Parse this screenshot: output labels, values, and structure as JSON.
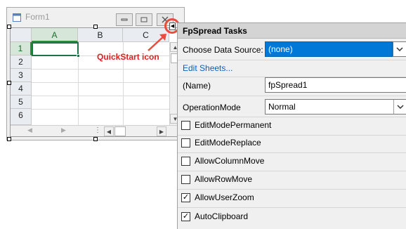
{
  "form": {
    "title": "Form1",
    "caption_buttons": [
      "minimize-button",
      "maximize-button",
      "close-button"
    ]
  },
  "spread": {
    "columns": [
      "A",
      "B",
      "C"
    ],
    "rows": [
      "1",
      "2",
      "3",
      "4",
      "5",
      "6"
    ],
    "selected_column": "A",
    "selected_row": "1"
  },
  "callout": {
    "label": "QuickStart icon",
    "color": "#e02020"
  },
  "tasks_panel": {
    "title": "FpSpread Tasks",
    "data_source_label": "Choose Data Source:",
    "data_source_value": "(none)",
    "edit_sheets_link": "Edit Sheets...",
    "name_label": "(Name)",
    "name_value": "fpSpread1",
    "operation_mode_label": "OperationMode",
    "operation_mode_value": "Normal",
    "options": [
      {
        "label": "EditModePermanent",
        "checked": false
      },
      {
        "label": "EditModeReplace",
        "checked": false
      },
      {
        "label": "AllowColumnMove",
        "checked": false
      },
      {
        "label": "AllowRowMove",
        "checked": false
      },
      {
        "label": "AllowUserZoom",
        "checked": true
      },
      {
        "label": "AutoClipboard",
        "checked": true
      }
    ],
    "check_mark": "✓"
  }
}
